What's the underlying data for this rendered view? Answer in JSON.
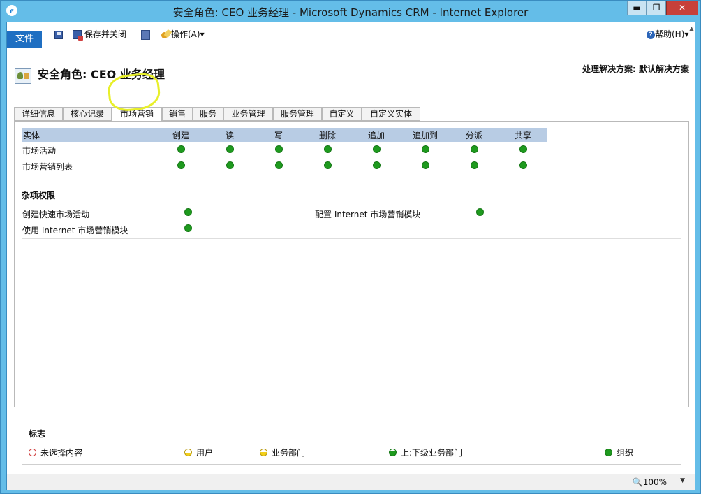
{
  "window": {
    "title": "安全角色: CEO 业务经理 - Microsoft Dynamics CRM - Internet Explorer",
    "min": "▬",
    "max": "❐",
    "close": "✕"
  },
  "ribbon": {
    "file": "文件",
    "save_close": "保存并关闭",
    "actions": "操作(A)",
    "actions_caret": "▾",
    "help": "帮助(H)",
    "help_caret": "▾"
  },
  "header": {
    "title": "安全角色: CEO 业务经理",
    "solution": "处理解决方案: 默认解决方案"
  },
  "tabs": [
    {
      "label": "详细信息",
      "active": false
    },
    {
      "label": "核心记录",
      "active": false
    },
    {
      "label": "市场营销",
      "active": true
    },
    {
      "label": "销售",
      "active": false
    },
    {
      "label": "服务",
      "active": false
    },
    {
      "label": "业务管理",
      "active": false
    },
    {
      "label": "服务管理",
      "active": false
    },
    {
      "label": "自定义",
      "active": false
    },
    {
      "label": "自定义实体",
      "active": false
    }
  ],
  "grid": {
    "columns": [
      "实体",
      "创建",
      "读",
      "写",
      "删除",
      "追加",
      "追加到",
      "分派",
      "共享"
    ],
    "rows": [
      {
        "label": "市场活动",
        "levels": [
          "组织",
          "组织",
          "组织",
          "组织",
          "组织",
          "组织",
          "组织",
          "组织"
        ]
      },
      {
        "label": "市场营销列表",
        "levels": [
          "组织",
          "组织",
          "组织",
          "组织",
          "组织",
          "组织",
          "组织",
          "组织"
        ]
      }
    ]
  },
  "misc": {
    "title": "杂项权限",
    "items": [
      {
        "label": "创建快速市场活动",
        "level": "组织"
      },
      {
        "label": "配置 Internet 市场营销模块",
        "level": "组织"
      },
      {
        "label": "使用 Internet 市场营销模块",
        "level": "组织"
      }
    ]
  },
  "legend": {
    "title": "标志",
    "items": [
      "未选择内容",
      "用户",
      "业务部门",
      "上:下级业务部门",
      "组织"
    ]
  },
  "status": {
    "zoom": "100%",
    "zoom_caret": "▼"
  },
  "colors": {
    "organization_dot": "#1e9a1e",
    "grid_header": "#b8cce4",
    "file_tab": "#1f6fc2",
    "titlebar": "#64bde8",
    "highlight": "#e8ef2a"
  }
}
